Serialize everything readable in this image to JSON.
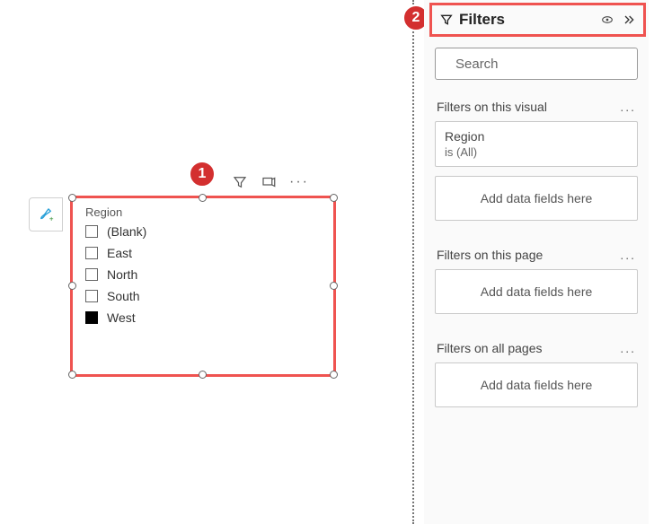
{
  "badges": {
    "one": "1",
    "two": "2"
  },
  "visual": {
    "title": "Region",
    "items": [
      {
        "label": "(Blank)",
        "checked": false
      },
      {
        "label": "East",
        "checked": false
      },
      {
        "label": "North",
        "checked": false
      },
      {
        "label": "South",
        "checked": false
      },
      {
        "label": "West",
        "checked": true
      }
    ]
  },
  "pane": {
    "title": "Filters",
    "search_placeholder": "Search",
    "sections": {
      "visual": {
        "heading": "Filters on this visual",
        "field": "Region",
        "summary": "is (All)",
        "dropzone": "Add data fields here"
      },
      "page": {
        "heading": "Filters on this page",
        "dropzone": "Add data fields here"
      },
      "all": {
        "heading": "Filters on all pages",
        "dropzone": "Add data fields here"
      }
    }
  }
}
